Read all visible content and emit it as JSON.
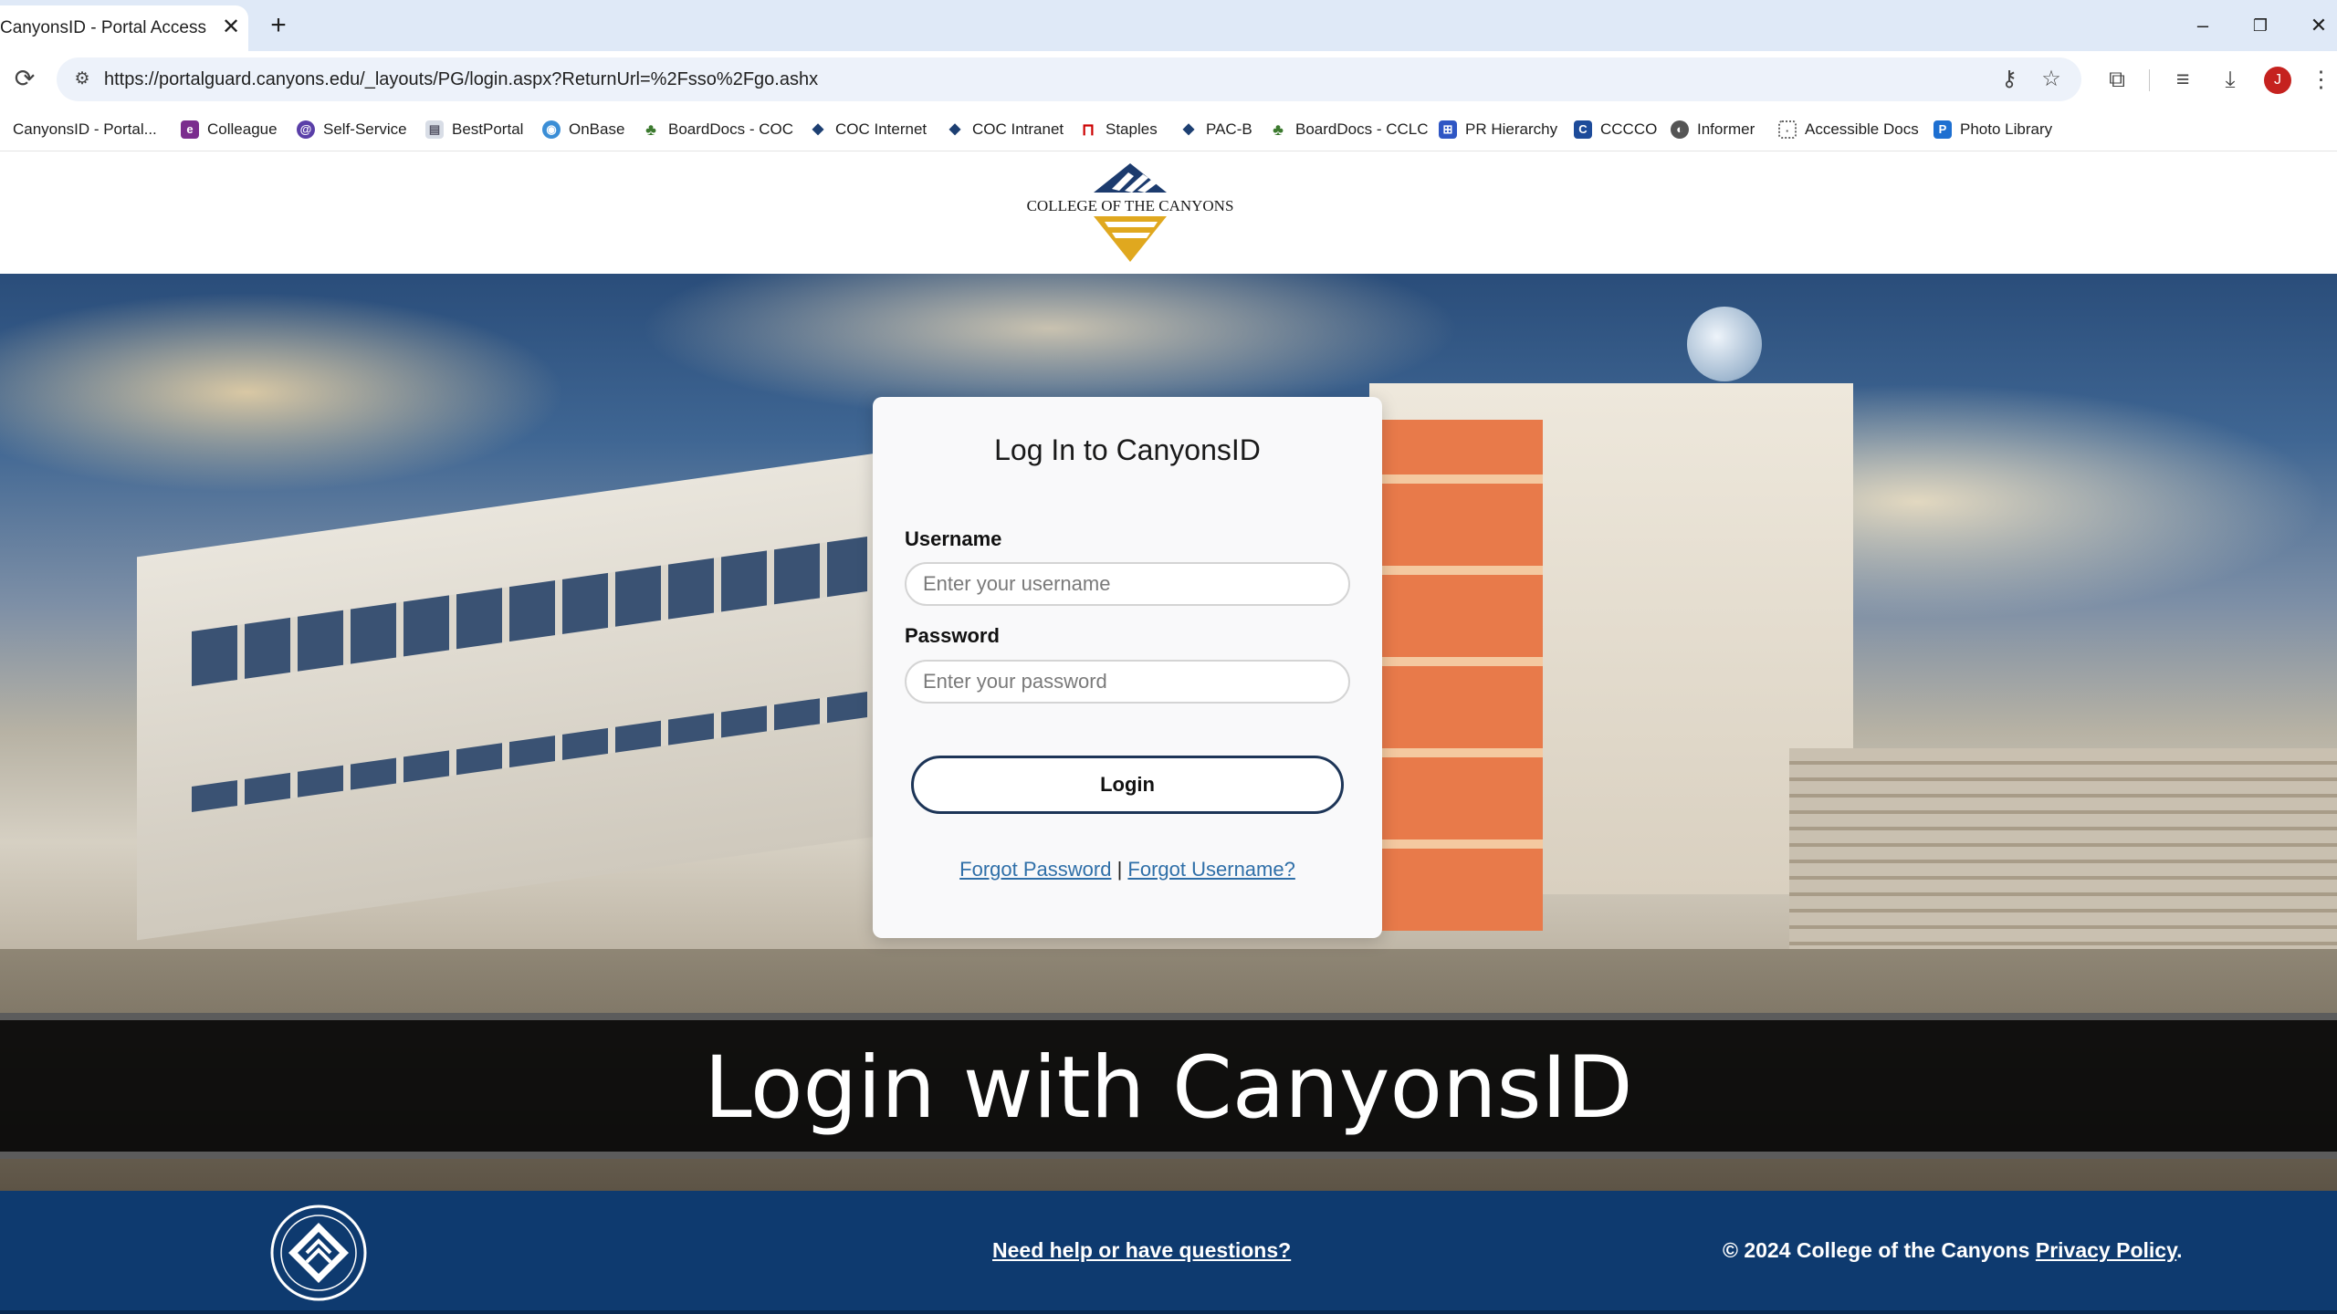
{
  "browser": {
    "tab_title": "CanyonsID - Portal Access",
    "url": "https://portalguard.canyons.edu/_layouts/PG/login.aspx?ReturnUrl=%2Fsso%2Fgo.ashx",
    "profile_initial": "J",
    "bookmarks": [
      {
        "label": "CanyonsID - Portal...",
        "icon": "canyons-icon",
        "color": "#1d3f72"
      },
      {
        "label": "Colleague",
        "icon": "colleague-icon",
        "color": "#7b2d8e"
      },
      {
        "label": "Self-Service",
        "icon": "self-service-icon",
        "color": "#5a3fa8"
      },
      {
        "label": "BestPortal",
        "icon": "page-icon",
        "color": "#9aa3b5"
      },
      {
        "label": "OnBase",
        "icon": "globe-icon",
        "color": "#3b8ed6"
      },
      {
        "label": "BoardDocs - COC",
        "icon": "tree-icon",
        "color": "#3c7a2f"
      },
      {
        "label": "COC Internet",
        "icon": "canyons-icon",
        "color": "#1d3f72"
      },
      {
        "label": "COC Intranet",
        "icon": "canyons-icon",
        "color": "#1d3f72"
      },
      {
        "label": "Staples",
        "icon": "staples-icon",
        "color": "#cc0000"
      },
      {
        "label": "PAC-B",
        "icon": "canyons-icon",
        "color": "#1d3f72"
      },
      {
        "label": "BoardDocs - CCLC",
        "icon": "tree-icon",
        "color": "#3c7a2f"
      },
      {
        "label": "PR Hierarchy",
        "icon": "org-chart-icon",
        "color": "#2f56c4"
      },
      {
        "label": "CCCCO",
        "icon": "cccco-icon",
        "color": "#1d4b9a"
      },
      {
        "label": "Informer",
        "icon": "informer-icon",
        "color": "#555555"
      },
      {
        "label": "Accessible Docs",
        "icon": "accessible-docs-icon",
        "color": "#666666"
      },
      {
        "label": "Photo Library",
        "icon": "photo-library-icon",
        "color": "#1d6fd1"
      }
    ]
  },
  "header": {
    "logo_text": "COLLEGE OF THE CANYONS"
  },
  "login": {
    "title": "Log In to CanyonsID",
    "username_label": "Username",
    "username_placeholder": "Enter your username",
    "password_label": "Password",
    "password_placeholder": "Enter your password",
    "login_button": "Login",
    "forgot_password": "Forgot Password",
    "separator": "|",
    "forgot_username": "Forgot Username?"
  },
  "caption": "Login with CanyonsID",
  "footer": {
    "help_link": "Need help or have questions?",
    "copyright": "© 2024 College of the Canyons",
    "privacy_link": "Privacy Policy",
    "period": "."
  },
  "colors": {
    "footer_bg": "#0e3a6f",
    "login_border": "#1d3557",
    "link": "#2f6fa8",
    "tab_strip": "#dfe9f7"
  }
}
